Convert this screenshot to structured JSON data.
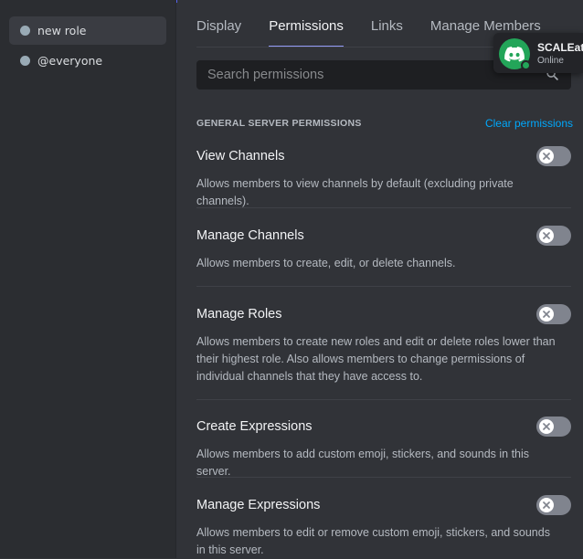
{
  "sidebar": {
    "roles": [
      {
        "label": "new role",
        "selected": true
      },
      {
        "label": "@everyone",
        "selected": false
      }
    ]
  },
  "tabs": [
    {
      "label": "Display",
      "active": false
    },
    {
      "label": "Permissions",
      "active": true
    },
    {
      "label": "Links",
      "active": false
    },
    {
      "label": "Manage Members",
      "active": false
    }
  ],
  "search": {
    "placeholder": "Search permissions"
  },
  "section": {
    "title": "GENERAL SERVER PERMISSIONS",
    "clear_label": "Clear permissions"
  },
  "permissions": [
    {
      "name": "View Channels",
      "description": "Allows members to view channels by default (excluding private channels).",
      "enabled": false
    },
    {
      "name": "Manage Channels",
      "description": "Allows members to create, edit, or delete channels.",
      "enabled": false
    },
    {
      "name": "Manage Roles",
      "description": "Allows members to create new roles and edit or delete roles lower than their highest role. Also allows members to change permissions of individual channels that they have access to.",
      "enabled": false
    },
    {
      "name": "Create Expressions",
      "description": "Allows members to add custom emoji, stickers, and sounds in this server.",
      "enabled": false
    },
    {
      "name": "Manage Expressions",
      "description": "Allows members to edit or remove custom emoji, stickers, and sounds in this server.",
      "enabled": false
    }
  ],
  "presence": {
    "name": "SCALEatt",
    "status": "Online",
    "icon": "discord-logo-icon"
  },
  "colors": {
    "accent": "#5865f2",
    "link": "#00a8fc",
    "online": "#23a559",
    "toggle_off": "#80848e"
  }
}
